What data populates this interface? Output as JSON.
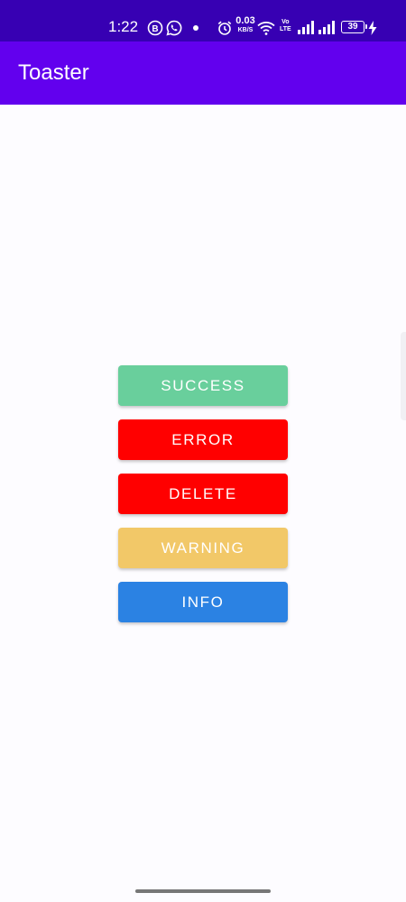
{
  "status_bar": {
    "time": "1:22",
    "net_speed_value": "0.03",
    "net_speed_unit": "KB/S",
    "volte_line1": "Vo",
    "volte_line2": "LTE",
    "battery_level": "39",
    "icons": [
      "b-notification-icon",
      "whatsapp-icon",
      "dot-icon",
      "alarm-icon",
      "wifi-icon",
      "signal-icon",
      "signal-icon",
      "battery-icon",
      "charging-icon"
    ]
  },
  "app_bar": {
    "title": "Toaster",
    "color": "#6200ee"
  },
  "buttons": [
    {
      "label": "SUCCESS",
      "color": "#69cf9c"
    },
    {
      "label": "ERROR",
      "color": "#ff0000"
    },
    {
      "label": "DELETE",
      "color": "#ff0000"
    },
    {
      "label": "WARNING",
      "color": "#f2c868"
    },
    {
      "label": "INFO",
      "color": "#2b82e3"
    }
  ]
}
